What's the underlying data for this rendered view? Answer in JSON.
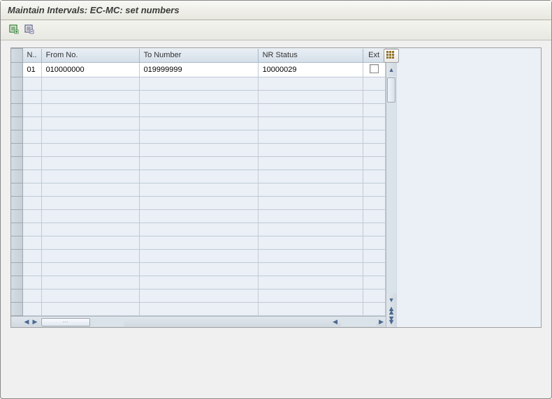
{
  "titlebar": {
    "title": "Maintain Intervals: EC-MC: set numbers"
  },
  "toolbar": {
    "new_interval_icon": "new-interval",
    "delete_interval_icon": "delete-interval"
  },
  "grid": {
    "headers": {
      "num": "N..",
      "from": "From No.",
      "to": "To Number",
      "nr": "NR Status",
      "ext": "Ext"
    },
    "rows": [
      {
        "num": "01",
        "from": "010000000",
        "to": "019999999",
        "nr": "10000029",
        "ext": false
      }
    ],
    "empty_row_count": 18
  },
  "scroll": {
    "config_icon": "table-settings",
    "up": "▲",
    "down": "▼",
    "dbl_up": "▲",
    "dbl_down": "▼",
    "left": "◀",
    "right": "▶"
  }
}
